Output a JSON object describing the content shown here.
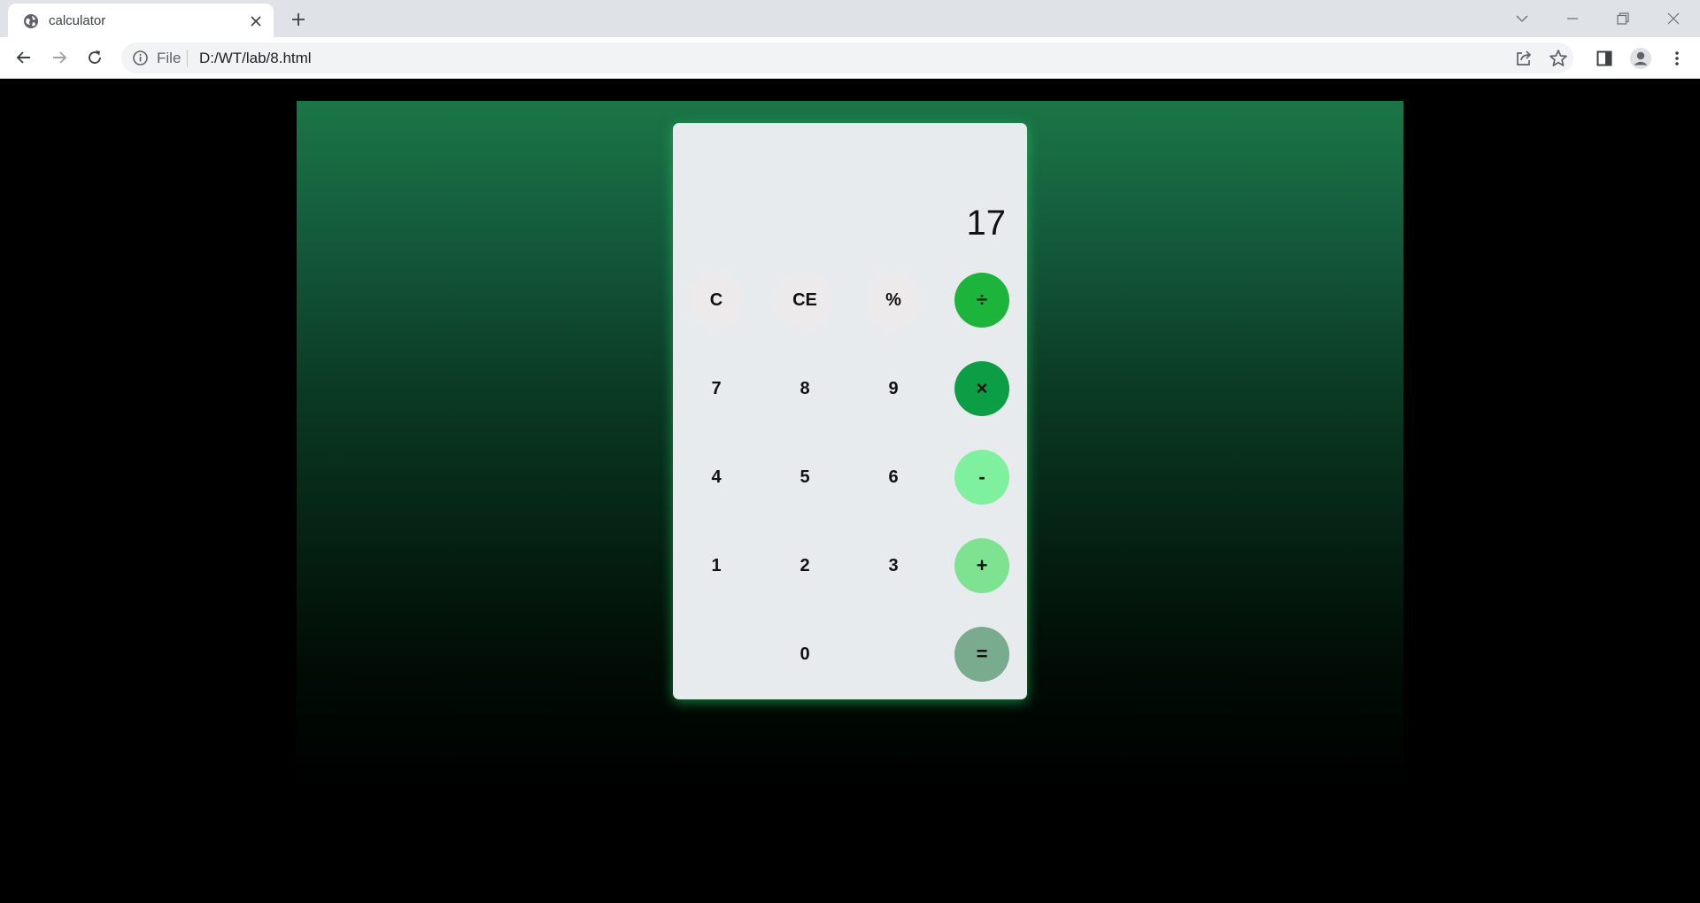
{
  "browser": {
    "tab_title": "calculator",
    "address_scheme": "File",
    "address_url": "D:/WT/lab/8.html"
  },
  "calculator": {
    "display": "17",
    "buttons": [
      {
        "label": "C",
        "kind": "fn"
      },
      {
        "label": "CE",
        "kind": "fn"
      },
      {
        "label": "%",
        "kind": "fn"
      },
      {
        "label": "÷",
        "kind": "op",
        "color": "#1db43c"
      },
      {
        "label": "7",
        "kind": "num"
      },
      {
        "label": "8",
        "kind": "num"
      },
      {
        "label": "9",
        "kind": "num"
      },
      {
        "label": "×",
        "kind": "op",
        "color": "#0c9e44"
      },
      {
        "label": "4",
        "kind": "num"
      },
      {
        "label": "5",
        "kind": "num"
      },
      {
        "label": "6",
        "kind": "num"
      },
      {
        "label": "-",
        "kind": "op",
        "color": "#7ff09d"
      },
      {
        "label": "1",
        "kind": "num"
      },
      {
        "label": "2",
        "kind": "num"
      },
      {
        "label": "3",
        "kind": "num"
      },
      {
        "label": "+",
        "kind": "op",
        "color": "#7ee391"
      },
      {
        "label": "0",
        "kind": "num"
      },
      {
        "label": "=",
        "kind": "op",
        "color": "#79ac8f"
      }
    ]
  }
}
